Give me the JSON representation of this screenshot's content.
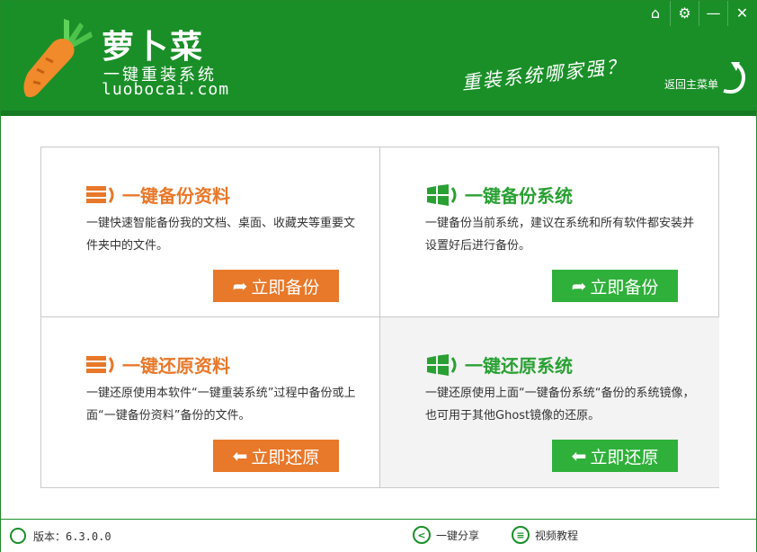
{
  "header": {
    "brand_name": "萝卜菜",
    "brand_sub": "一键重装系统",
    "brand_url": "luobocai.com",
    "slogan": "重装系统哪家强？",
    "back_menu_label": "返回主菜单",
    "bg_color": "#1a8f28"
  },
  "window_buttons": [
    {
      "name": "home-icon",
      "glyph": "⌂"
    },
    {
      "name": "gear-icon",
      "glyph": "⚙"
    },
    {
      "name": "minimize-icon",
      "glyph": "—"
    },
    {
      "name": "close-icon",
      "glyph": "✕"
    }
  ],
  "cards": {
    "backup_data": {
      "title": "一键备份资料",
      "desc": "一键快速智能备份我的文档、桌面、收藏夹等重要文件夹中的文件。",
      "button": "立即备份",
      "icon": "database-icon",
      "color": "#e8782a"
    },
    "backup_system": {
      "title": "一键备份系统",
      "desc": "一键备份当前系统，建议在系统和所有软件都安装并设置好后进行备份。",
      "button": "立即备份",
      "icon": "windows-icon",
      "color": "#2aa033"
    },
    "restore_data": {
      "title": "一键还原资料",
      "desc": "一键还原使用本软件“一键重装系统”过程中备份或上面“一键备份资料”备份的文件。",
      "button": "立即还原",
      "icon": "database-icon",
      "color": "#e8782a"
    },
    "restore_system": {
      "title": "一键还原系统",
      "desc": "一键还原使用上面“一键备份系统“备份的系统镜像，也可用于其他Ghost镜像的还原。",
      "button": "立即还原",
      "icon": "windows-icon",
      "color": "#2aa033"
    }
  },
  "footer": {
    "version": "版本：6.3.0.0",
    "share": "一键分享",
    "video": "视频教程"
  }
}
